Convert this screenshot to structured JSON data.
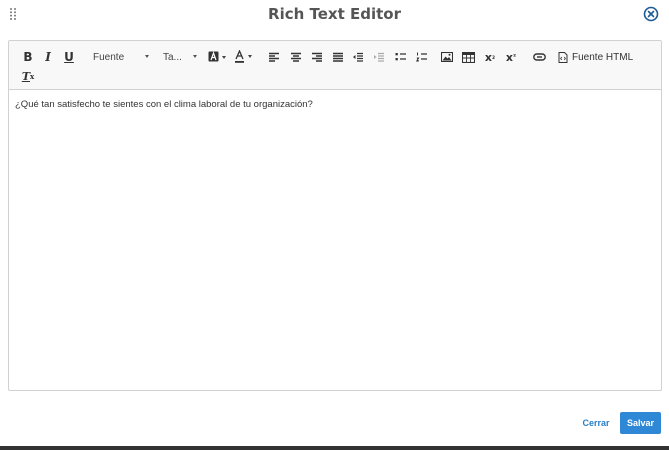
{
  "dialog": {
    "title": "Rich Text Editor"
  },
  "toolbar": {
    "bold": "B",
    "italic": "I",
    "underline": "U",
    "font_combo": "Fuente",
    "size_combo": "Ta...",
    "subscript": "x",
    "superscript": "x",
    "source_label": "Fuente HTML",
    "remove_format": "T"
  },
  "editor": {
    "content": "¿Qué tan satisfecho te sientes con el clima laboral de tu organización?"
  },
  "footer": {
    "cancel_label": "Cerrar",
    "save_label": "Salvar"
  },
  "colors": {
    "accent": "#2f88d6",
    "link": "#2a7fc7",
    "toolbar_bg": "#f8f8f8",
    "border": "#d1d1d1"
  }
}
